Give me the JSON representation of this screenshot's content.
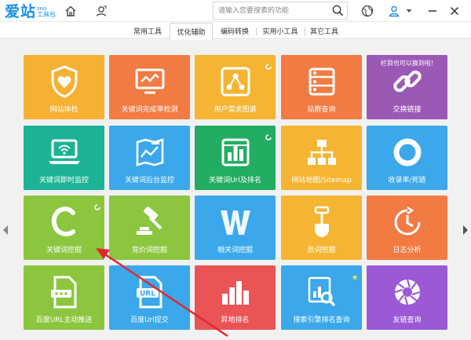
{
  "app": {
    "logo_main": "爱站",
    "logo_seo": "seo",
    "logo_sub": "工具包",
    "search": {
      "placeholder": "请输入您要搜索的功能"
    }
  },
  "tabs": [
    {
      "label": "常用工具",
      "active": false
    },
    {
      "label": "优化辅助",
      "active": true
    },
    {
      "label": "编码转换",
      "active": false
    },
    {
      "label": "实用小工具",
      "active": false
    },
    {
      "label": "其它工具",
      "active": false
    }
  ],
  "hint": "栏目也可以换到啦!",
  "tiles": [
    {
      "label": "网站体检",
      "color": "#f6b133",
      "icon": "shield-heart-icon",
      "badge": ""
    },
    {
      "label": "关键词完成率检测",
      "color": "#f27b43",
      "icon": "monitor-chart-icon",
      "badge": ""
    },
    {
      "label": "用户需求图谱",
      "color": "#f5b532",
      "icon": "graph-nodes-icon",
      "badge": "new"
    },
    {
      "label": "站群查询",
      "color": "#f27b43",
      "icon": "server-list-icon",
      "badge": ""
    },
    {
      "label": "交换链接",
      "color": "#9b59b6",
      "icon": "chain-link-icon",
      "badge": ""
    },
    {
      "label": "关键词即时监控",
      "color": "#1bb394",
      "icon": "laptop-wifi-icon",
      "badge": ""
    },
    {
      "label": "关键词后台监控",
      "color": "#3aa8ea",
      "icon": "map-trend-icon",
      "badge": ""
    },
    {
      "label": "关键词Url及排名",
      "color": "#22ad62",
      "icon": "bar-chart-icon",
      "badge": "new"
    },
    {
      "label": "网站地图/Sitemap",
      "color": "#f5b532",
      "icon": "sitemap-icon",
      "badge": ""
    },
    {
      "label": "收录率/死链",
      "color": "#3aa8ea",
      "icon": "ring-icon",
      "badge": ""
    },
    {
      "label": "关键词挖掘",
      "color": "#8cc63f",
      "icon": "letter-c-icon",
      "badge": "new"
    },
    {
      "label": "竞价词挖掘",
      "color": "#8cc63f",
      "icon": "gavel-icon",
      "badge": ""
    },
    {
      "label": "相关词挖掘",
      "color": "#3aa8ea",
      "icon": "letter-w-icon",
      "badge": ""
    },
    {
      "label": "热词挖掘",
      "color": "#f5b532",
      "icon": "shovel-icon",
      "badge": ""
    },
    {
      "label": "日志分析",
      "color": "#f27b43",
      "icon": "clock-icon",
      "badge": ""
    },
    {
      "label": "百度URL主动推送",
      "color": "#8cc63f",
      "icon": "file-dots-icon",
      "badge": ""
    },
    {
      "label": "百度Url提交",
      "color": "#3aa8ea",
      "icon": "file-url-icon",
      "badge": ""
    },
    {
      "label": "异地排名",
      "color": "#ea5455",
      "icon": "rank-bars-icon",
      "badge": ""
    },
    {
      "label": "搜索引擎排名查询",
      "color": "#3aa8ea",
      "icon": "search-chart-icon",
      "badge": "star"
    },
    {
      "label": "友链查询",
      "color": "#9b59d6",
      "icon": "aperture-icon",
      "badge": ""
    }
  ]
}
